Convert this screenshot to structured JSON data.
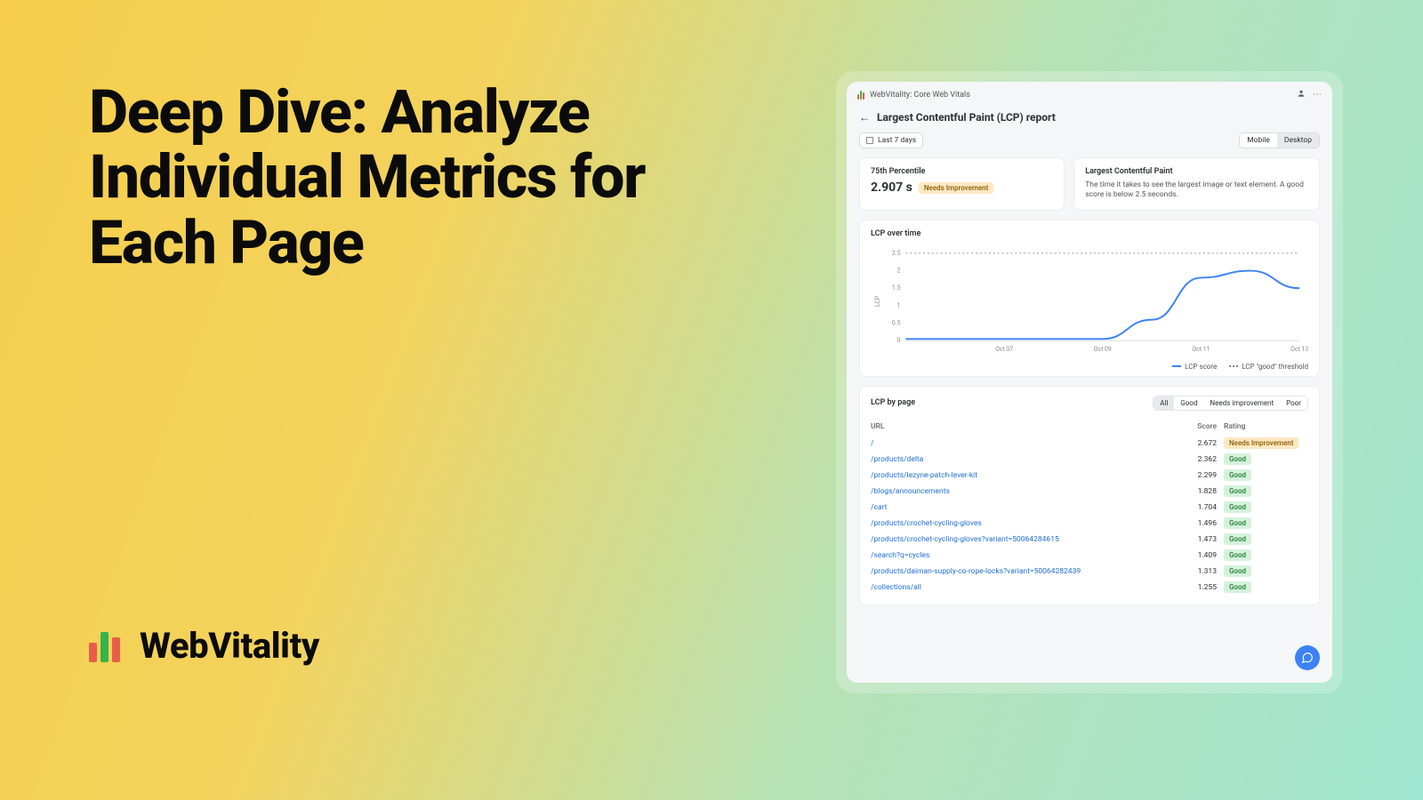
{
  "hero": {
    "headline": "Deep Dive: Analyze Individual Metrics for Each Page",
    "brand": "WebVitality"
  },
  "app": {
    "topbar_title": "WebVitality: Core Web Vitals",
    "report_title": "Largest Contentful Paint (LCP) report",
    "date_range": "Last 7 days",
    "device_tabs": {
      "mobile": "Mobile",
      "desktop": "Desktop",
      "active": "desktop"
    },
    "percentile_card": {
      "title": "75th Percentile",
      "value": "2.907 s",
      "badge": "Needs Improvement"
    },
    "desc_card": {
      "title": "Largest Contentful Paint",
      "desc": "The time it takes to see the largest image or text element. A good score is below 2.5 seconds."
    },
    "chart": {
      "title": "LCP over time",
      "y_label": "LCP",
      "legend_score": "LCP score",
      "legend_threshold": "LCP \"good\" threshold"
    },
    "table": {
      "title": "LCP by page",
      "filters": {
        "all": "All",
        "good": "Good",
        "needs": "Needs improvement",
        "poor": "Poor",
        "active": "all"
      },
      "cols": {
        "url": "URL",
        "score": "Score",
        "rating": "Rating"
      },
      "rows": [
        {
          "url": "/",
          "score": "2.672",
          "rating": "Needs Improvement",
          "class": "needs"
        },
        {
          "url": "/products/delta",
          "score": "2.362",
          "rating": "Good",
          "class": "good"
        },
        {
          "url": "/products/lezyne-patch-lever-kit",
          "score": "2.299",
          "rating": "Good",
          "class": "good"
        },
        {
          "url": "/blogs/announcements",
          "score": "1.828",
          "rating": "Good",
          "class": "good"
        },
        {
          "url": "/cart",
          "score": "1.704",
          "rating": "Good",
          "class": "good"
        },
        {
          "url": "/products/crochet-cycling-gloves",
          "score": "1.496",
          "rating": "Good",
          "class": "good"
        },
        {
          "url": "/products/crochet-cycling-gloves?variant=50064284615",
          "score": "1.473",
          "rating": "Good",
          "class": "good"
        },
        {
          "url": "/search?q=cycles",
          "score": "1.409",
          "rating": "Good",
          "class": "good"
        },
        {
          "url": "/products/daiman-supply-co-rope-locks?variant=50064282439",
          "score": "1.313",
          "rating": "Good",
          "class": "good"
        },
        {
          "url": "/collections/all",
          "score": "1.255",
          "rating": "Good",
          "class": "good"
        }
      ]
    }
  },
  "chart_data": {
    "type": "line",
    "title": "LCP over time",
    "xlabel": "",
    "ylabel": "LCP",
    "ylim": [
      0,
      2.5
    ],
    "x_ticks": [
      "Oct 07",
      "Oct 09",
      "Oct 11",
      "Oct 13"
    ],
    "y_ticks": [
      0,
      0.5,
      1,
      1.5,
      2,
      2.5
    ],
    "threshold": 2.5,
    "series": [
      {
        "name": "LCP score",
        "x": [
          "Oct 05",
          "Oct 06",
          "Oct 07",
          "Oct 08",
          "Oct 09",
          "Oct 10",
          "Oct 11",
          "Oct 12",
          "Oct 13"
        ],
        "values": [
          0.05,
          0.05,
          0.05,
          0.05,
          0.05,
          0.6,
          1.8,
          2.0,
          1.5
        ]
      }
    ]
  }
}
